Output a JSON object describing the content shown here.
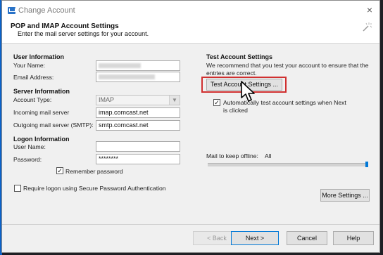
{
  "window": {
    "title": "Change Account",
    "close": "×"
  },
  "header": {
    "title": "POP and IMAP Account Settings",
    "subtitle": "Enter the mail server settings for your account."
  },
  "user_info": {
    "heading": "User Information",
    "your_name_label": "Your Name:",
    "email_label": "Email Address:"
  },
  "server_info": {
    "heading": "Server Information",
    "account_type_label": "Account Type:",
    "account_type_value": "IMAP",
    "incoming_label": "Incoming mail server",
    "incoming_value": "imap.comcast.net",
    "outgoing_label": "Outgoing mail server (SMTP):",
    "outgoing_value": "smtp.comcast.net"
  },
  "logon_info": {
    "heading": "Logon Information",
    "username_label": "User Name:",
    "password_label": "Password:",
    "password_value": "********",
    "remember_label": "Remember password",
    "remember_checked": "✓",
    "spa_label": "Require logon using Secure Password Authentication"
  },
  "test_settings": {
    "heading": "Test Account Settings",
    "description_line1": "We recommend that you test your account to ensure that the",
    "description_line2": "entries are correct.",
    "test_button": "Test Account Settings ...",
    "auto_test_line1": "Automatically test account settings when Next",
    "auto_test_line2": "is clicked",
    "auto_test_checked": "✓"
  },
  "offline": {
    "label": "Mail to keep offline:",
    "value": "All",
    "level_percent": 100
  },
  "buttons": {
    "more_settings": "More Settings ...",
    "back": "< Back",
    "next": "Next >",
    "cancel": "Cancel",
    "help": "Help"
  }
}
